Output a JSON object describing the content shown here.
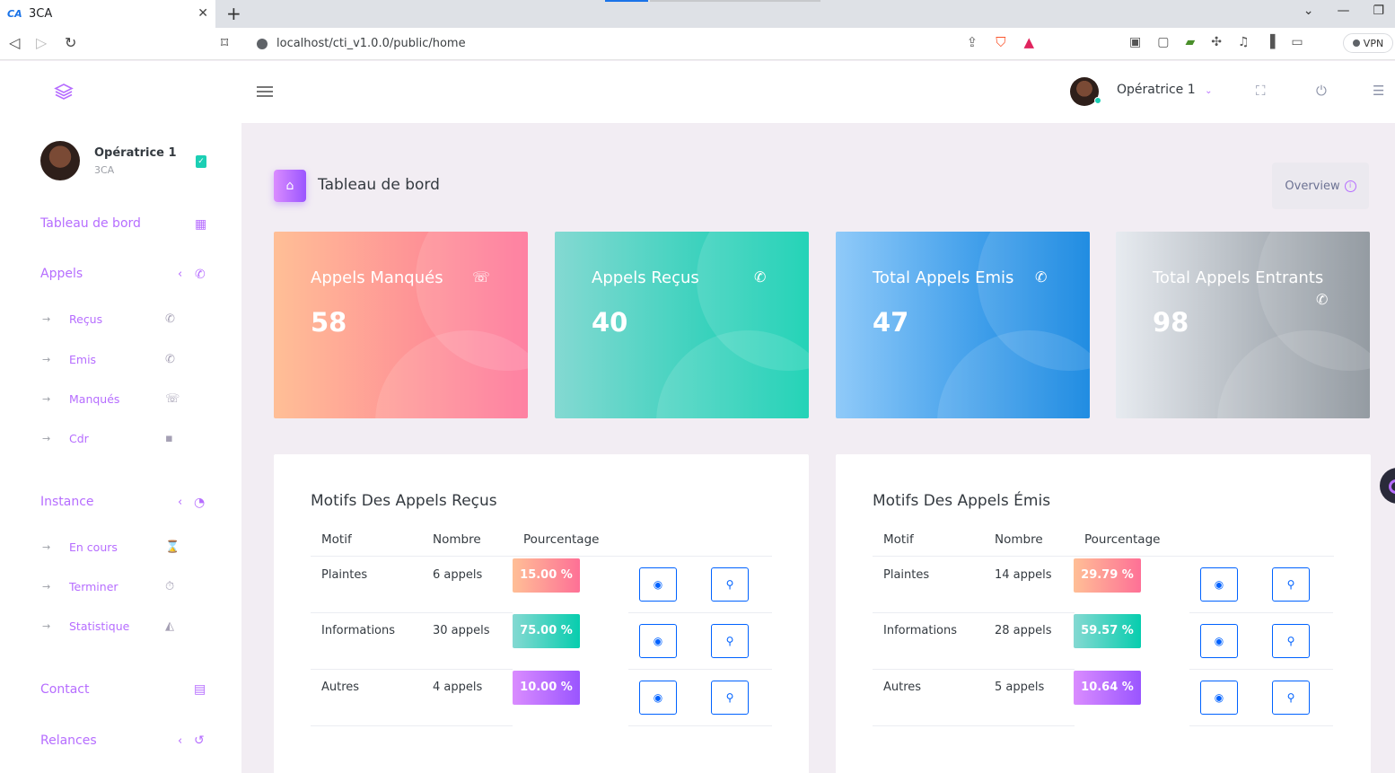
{
  "browser": {
    "tab_title": "3CA",
    "favicon_text": "CA",
    "url": "localhost/cti_v1.0.0/public/home",
    "vpn_label": "VPN"
  },
  "sidebar": {
    "user_name": "Opératrice 1",
    "user_org": "3CA",
    "items": {
      "dashboard": "Tableau de bord",
      "appels": "Appels",
      "recus": "Reçus",
      "emis": "Emis",
      "manques": "Manqués",
      "cdr": "Cdr",
      "instance": "Instance",
      "en_cours": "En cours",
      "terminer": "Terminer",
      "statistique": "Statistique",
      "contact": "Contact",
      "relances": "Relances"
    }
  },
  "topbar": {
    "user_name": "Opératrice 1"
  },
  "page": {
    "title": "Tableau de bord",
    "overview_label": "Overview"
  },
  "stats": [
    {
      "title": "Appels Manqués",
      "value": "58",
      "icon": "missed-call-icon"
    },
    {
      "title": "Appels Reçus",
      "value": "40",
      "icon": "incoming-call-icon"
    },
    {
      "title": "Total Appels Emis",
      "value": "47",
      "icon": "outgoing-call-icon"
    },
    {
      "title": "Total Appels Entrants",
      "value": "98",
      "icon": "incoming-call-icon"
    }
  ],
  "tables": [
    {
      "title": "Motifs Des Appels Reçus",
      "headers": [
        "Motif",
        "Nombre",
        "Pourcentage"
      ],
      "rows": [
        {
          "motif": "Plaintes",
          "nombre": "6 appels",
          "pct": "15.00 %"
        },
        {
          "motif": "Informations",
          "nombre": "30 appels",
          "pct": "75.00 %"
        },
        {
          "motif": "Autres",
          "nombre": "4 appels",
          "pct": "10.00 %"
        }
      ]
    },
    {
      "title": "Motifs Des Appels Émis",
      "headers": [
        "Motif",
        "Nombre",
        "Pourcentage"
      ],
      "rows": [
        {
          "motif": "Plaintes",
          "nombre": "14 appels",
          "pct": "29.79 %"
        },
        {
          "motif": "Informations",
          "nombre": "28 appels",
          "pct": "59.57 %"
        },
        {
          "motif": "Autres",
          "nombre": "5 appels",
          "pct": "10.64 %"
        }
      ]
    }
  ],
  "colors": {
    "accent": "#b66dff",
    "danger": "#fe7096",
    "success": "#07cdae",
    "info": "#047edf",
    "primary_btn": "#0062ff"
  }
}
